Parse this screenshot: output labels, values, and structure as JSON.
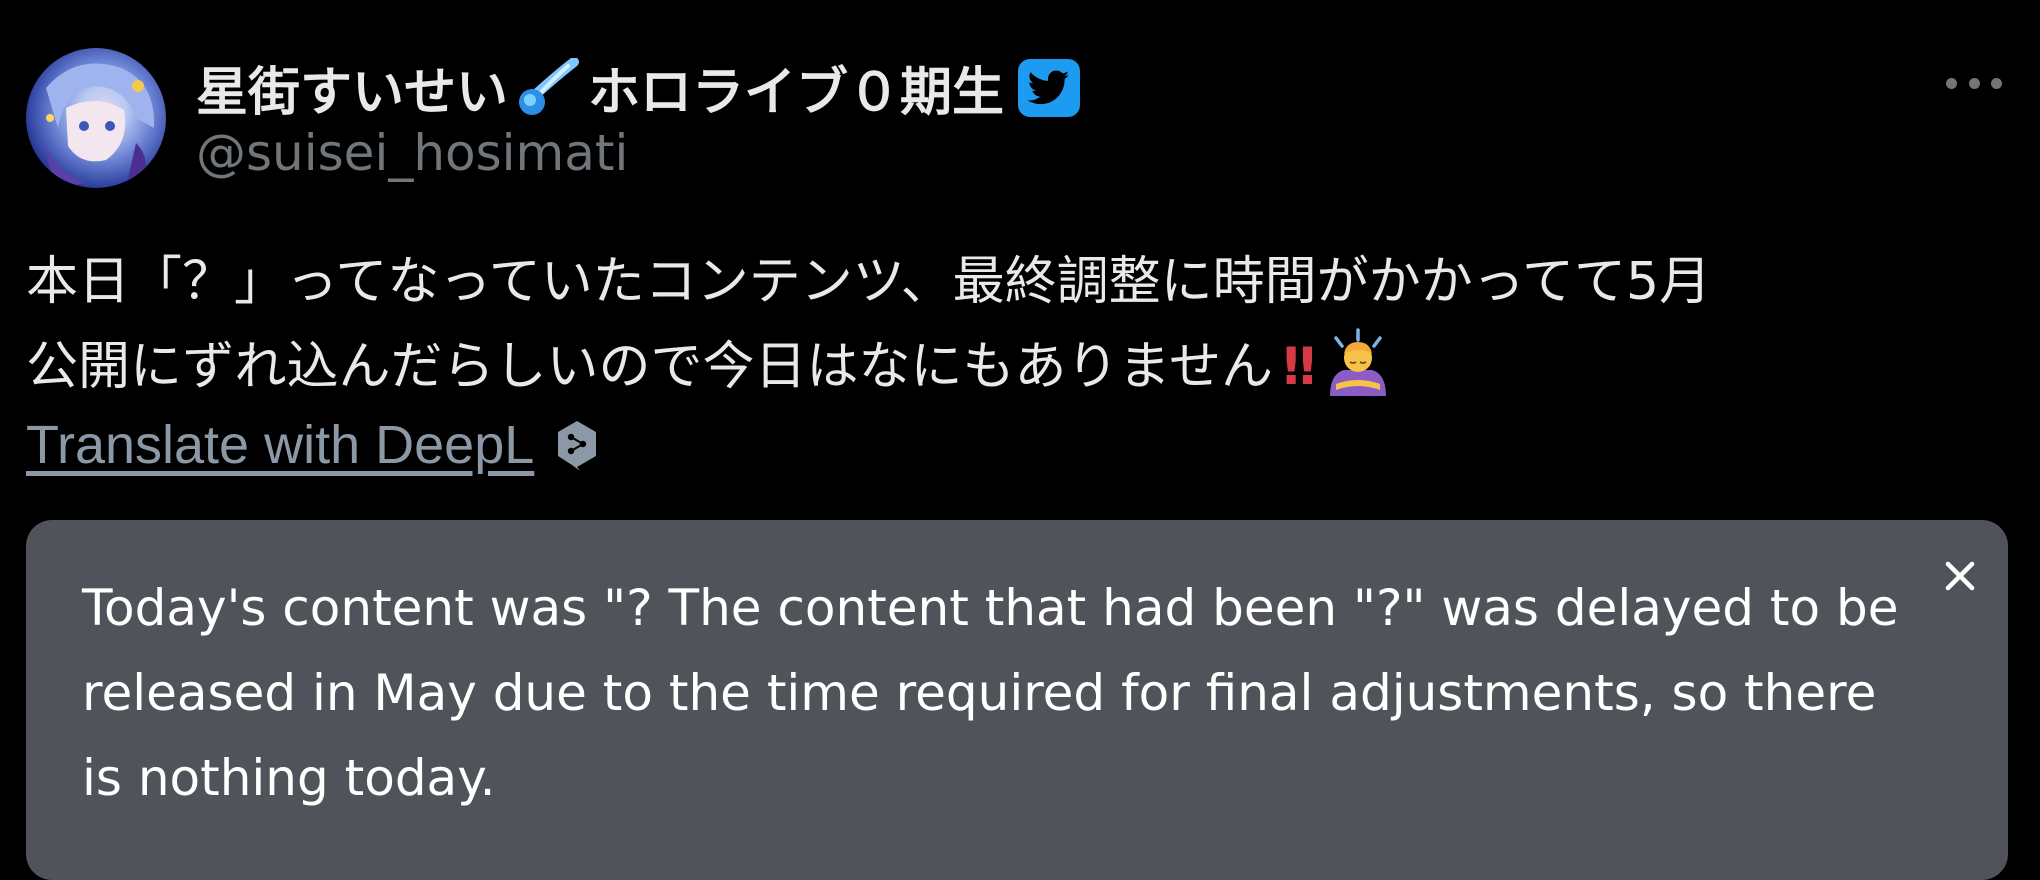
{
  "author": {
    "display_name": "星街すいせい",
    "display_name_suffix": "ホロライブ０期生",
    "handle": "@suisei_hosimati",
    "badge_color": "#1d9bf0",
    "icons": [
      "comet-icon",
      "verified-badge-icon",
      "more-options-icon"
    ]
  },
  "tweet": {
    "lines": [
      "本日「？」ってなっていたコンテンツ、最終調整に時間がかかってて5月",
      "公開にずれ込んだらしいので今日はなにもありません"
    ],
    "emoji_bang": "‼",
    "emoji_person": "person-bowing-emoji"
  },
  "translate": {
    "link_label": "Translate with DeepL",
    "icon": "deepl-icon"
  },
  "translation": {
    "lines": [
      "Today's content was \"? The content that had been \"?\" was delayed to be",
      "released in May due to the time required for final adjustments, so there",
      "is nothing today."
    ],
    "close_icon": "close-icon",
    "panel_color": "#50545a"
  }
}
